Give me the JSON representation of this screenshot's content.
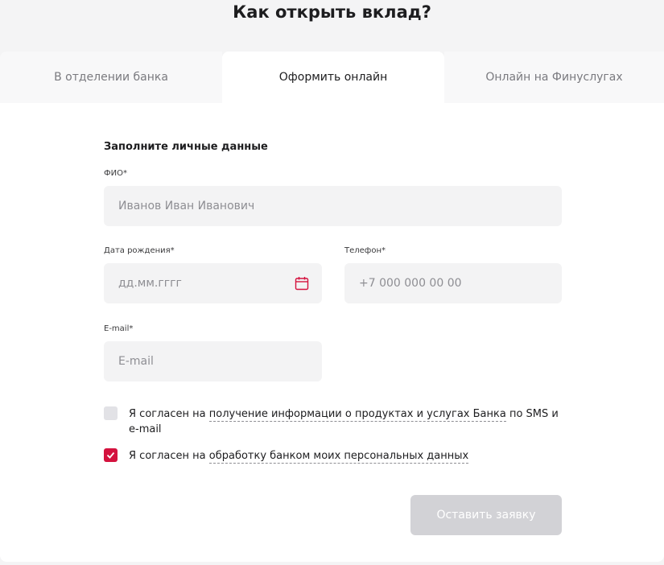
{
  "page": {
    "title": "Как открыть вклад?"
  },
  "tabs": [
    {
      "label": "В отделении банка",
      "active": false
    },
    {
      "label": "Оформить онлайн",
      "active": true
    },
    {
      "label": "Онлайн на Финуслугах",
      "active": false
    }
  ],
  "form": {
    "heading": "Заполните личные данные",
    "fio": {
      "label": "ФИО*",
      "placeholder": "Иванов Иван Иванович",
      "value": ""
    },
    "birthdate": {
      "label": "Дата рождения*",
      "placeholder": "дд.мм.гггг",
      "value": "",
      "icon": "calendar-icon"
    },
    "phone": {
      "label": "Телефон*",
      "placeholder": "+7 000 000 00 00",
      "value": ""
    },
    "email": {
      "label": "E-mail*",
      "placeholder": "E-mail",
      "value": ""
    },
    "consent_marketing": {
      "prefix": "Я согласен на ",
      "link": "получение информации о продуктах и услугах Банка",
      "suffix": " по SMS и e-mail",
      "checked": false
    },
    "consent_personal": {
      "prefix": "Я согласен на ",
      "link": "обработку банком моих персональных данных",
      "checked": true
    },
    "submit_label": "Оставить заявку"
  },
  "colors": {
    "accent": "#d4123e",
    "field_bg": "#f3f3f4",
    "button_disabled": "#d2d2d6",
    "page_bg": "#f4f4f5"
  }
}
